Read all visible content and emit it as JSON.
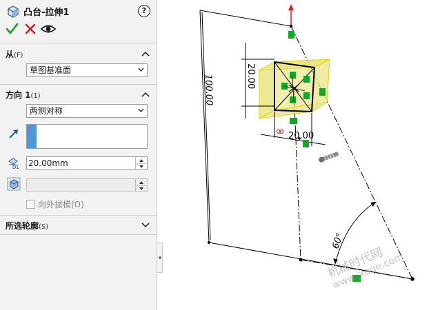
{
  "panel": {
    "title": "凸台-拉伸1",
    "help_label": "?",
    "icons": {
      "title": "extrude-boss-icon",
      "ok": "checkmark-icon",
      "cancel": "close-icon",
      "preview": "eye-icon"
    },
    "sections": {
      "from": {
        "title": "从",
        "shortcut": "(F)",
        "selected": "草图基准面"
      },
      "direction1": {
        "title": "方向 1",
        "shortcut": "(1)",
        "end_condition": "两侧对称",
        "depth_value": "20.00mm",
        "draft_value": "",
        "draft_outward_label": "向外拔模(O)",
        "draft_outward_checked": false
      },
      "selected_contours": {
        "title": "所选轮廓",
        "shortcut": "(S)"
      }
    }
  },
  "viewport": {
    "dimensions": {
      "length": "100.00",
      "height": "20.00",
      "width": "20.00",
      "angle": "60°"
    },
    "watermark": {
      "line1": "机械时代网",
      "line2": "www.jxage.com"
    }
  },
  "colors": {
    "ok": "#2aa12a",
    "cancel": "#d01c1c",
    "selection_bar": "#4e97dc",
    "preview_fill": "#e6e070",
    "preview_edge": "#e0d800",
    "handle": "#0faa2a",
    "axis_red": "#e02020"
  }
}
